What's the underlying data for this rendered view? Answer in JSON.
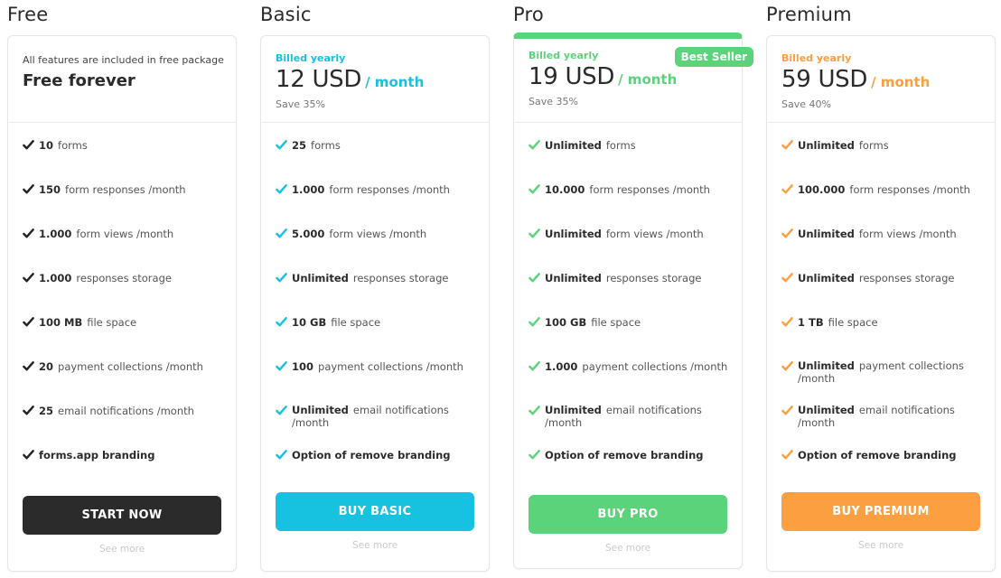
{
  "plans": [
    {
      "name": "Free",
      "note": "All features are included in free package",
      "title": "Free forever",
      "accent": "#222222",
      "features": [
        {
          "value": "10",
          "label": "forms"
        },
        {
          "value": "150",
          "label": "form responses /month"
        },
        {
          "value": "1.000",
          "label": "form views /month"
        },
        {
          "value": "1.000",
          "label": "responses storage"
        },
        {
          "value": "100 MB",
          "label": "file space"
        },
        {
          "value": "20",
          "label": "payment collections /month"
        },
        {
          "value": "25",
          "label": "email notifications /month"
        },
        {
          "value": "",
          "label": "forms.app branding"
        }
      ],
      "cta": "START NOW",
      "cta_color": "#2b2b2b",
      "see_more": "See more"
    },
    {
      "name": "Basic",
      "billed": "Billed yearly",
      "price": "12 USD",
      "per": "/ month",
      "save": "Save 35%",
      "accent": "#17c1e0",
      "features": [
        {
          "value": "25",
          "label": "forms"
        },
        {
          "value": "1.000",
          "label": "form responses /month"
        },
        {
          "value": "5.000",
          "label": "form views /month"
        },
        {
          "value": "Unlimited",
          "label": "responses storage"
        },
        {
          "value": "10 GB",
          "label": "file space"
        },
        {
          "value": "100",
          "label": "payment collections /month"
        },
        {
          "value": "Unlimited",
          "label": "email notifications /month"
        },
        {
          "value": "",
          "label": "Option of remove branding"
        }
      ],
      "cta": "BUY BASIC",
      "cta_color": "#17c1e0",
      "see_more": "See more"
    },
    {
      "name": "Pro",
      "billed": "Billed yearly",
      "price": "19 USD",
      "per": "/ month",
      "save": "Save 35%",
      "badge": "Best Seller",
      "accent": "#5bd37a",
      "features": [
        {
          "value": "Unlimited",
          "label": "forms"
        },
        {
          "value": "10.000",
          "label": "form responses /month"
        },
        {
          "value": "Unlimited",
          "label": "form views /month"
        },
        {
          "value": "Unlimited",
          "label": "responses storage"
        },
        {
          "value": "100 GB",
          "label": "file space"
        },
        {
          "value": "1.000",
          "label": "payment collections /month"
        },
        {
          "value": "Unlimited",
          "label": "email notifications /month"
        },
        {
          "value": "",
          "label": "Option of remove branding"
        }
      ],
      "cta": "BUY PRO",
      "cta_color": "#5bd37a",
      "see_more": "See more"
    },
    {
      "name": "Premium",
      "billed": "Billed yearly",
      "price": "59 USD",
      "per": "/ month",
      "save": "Save 40%",
      "accent": "#fb9f40",
      "features": [
        {
          "value": "Unlimited",
          "label": "forms"
        },
        {
          "value": "100.000",
          "label": "form responses /month"
        },
        {
          "value": "Unlimited",
          "label": "form views /month"
        },
        {
          "value": "Unlimited",
          "label": "responses storage"
        },
        {
          "value": "1 TB",
          "label": "file space"
        },
        {
          "value": "Unlimited",
          "label": "payment collections /month"
        },
        {
          "value": "Unlimited",
          "label": "email notifications /month"
        },
        {
          "value": "",
          "label": "Option of remove branding"
        }
      ],
      "cta": "BUY PREMIUM",
      "cta_color": "#fb9f40",
      "see_more": "See more"
    }
  ]
}
